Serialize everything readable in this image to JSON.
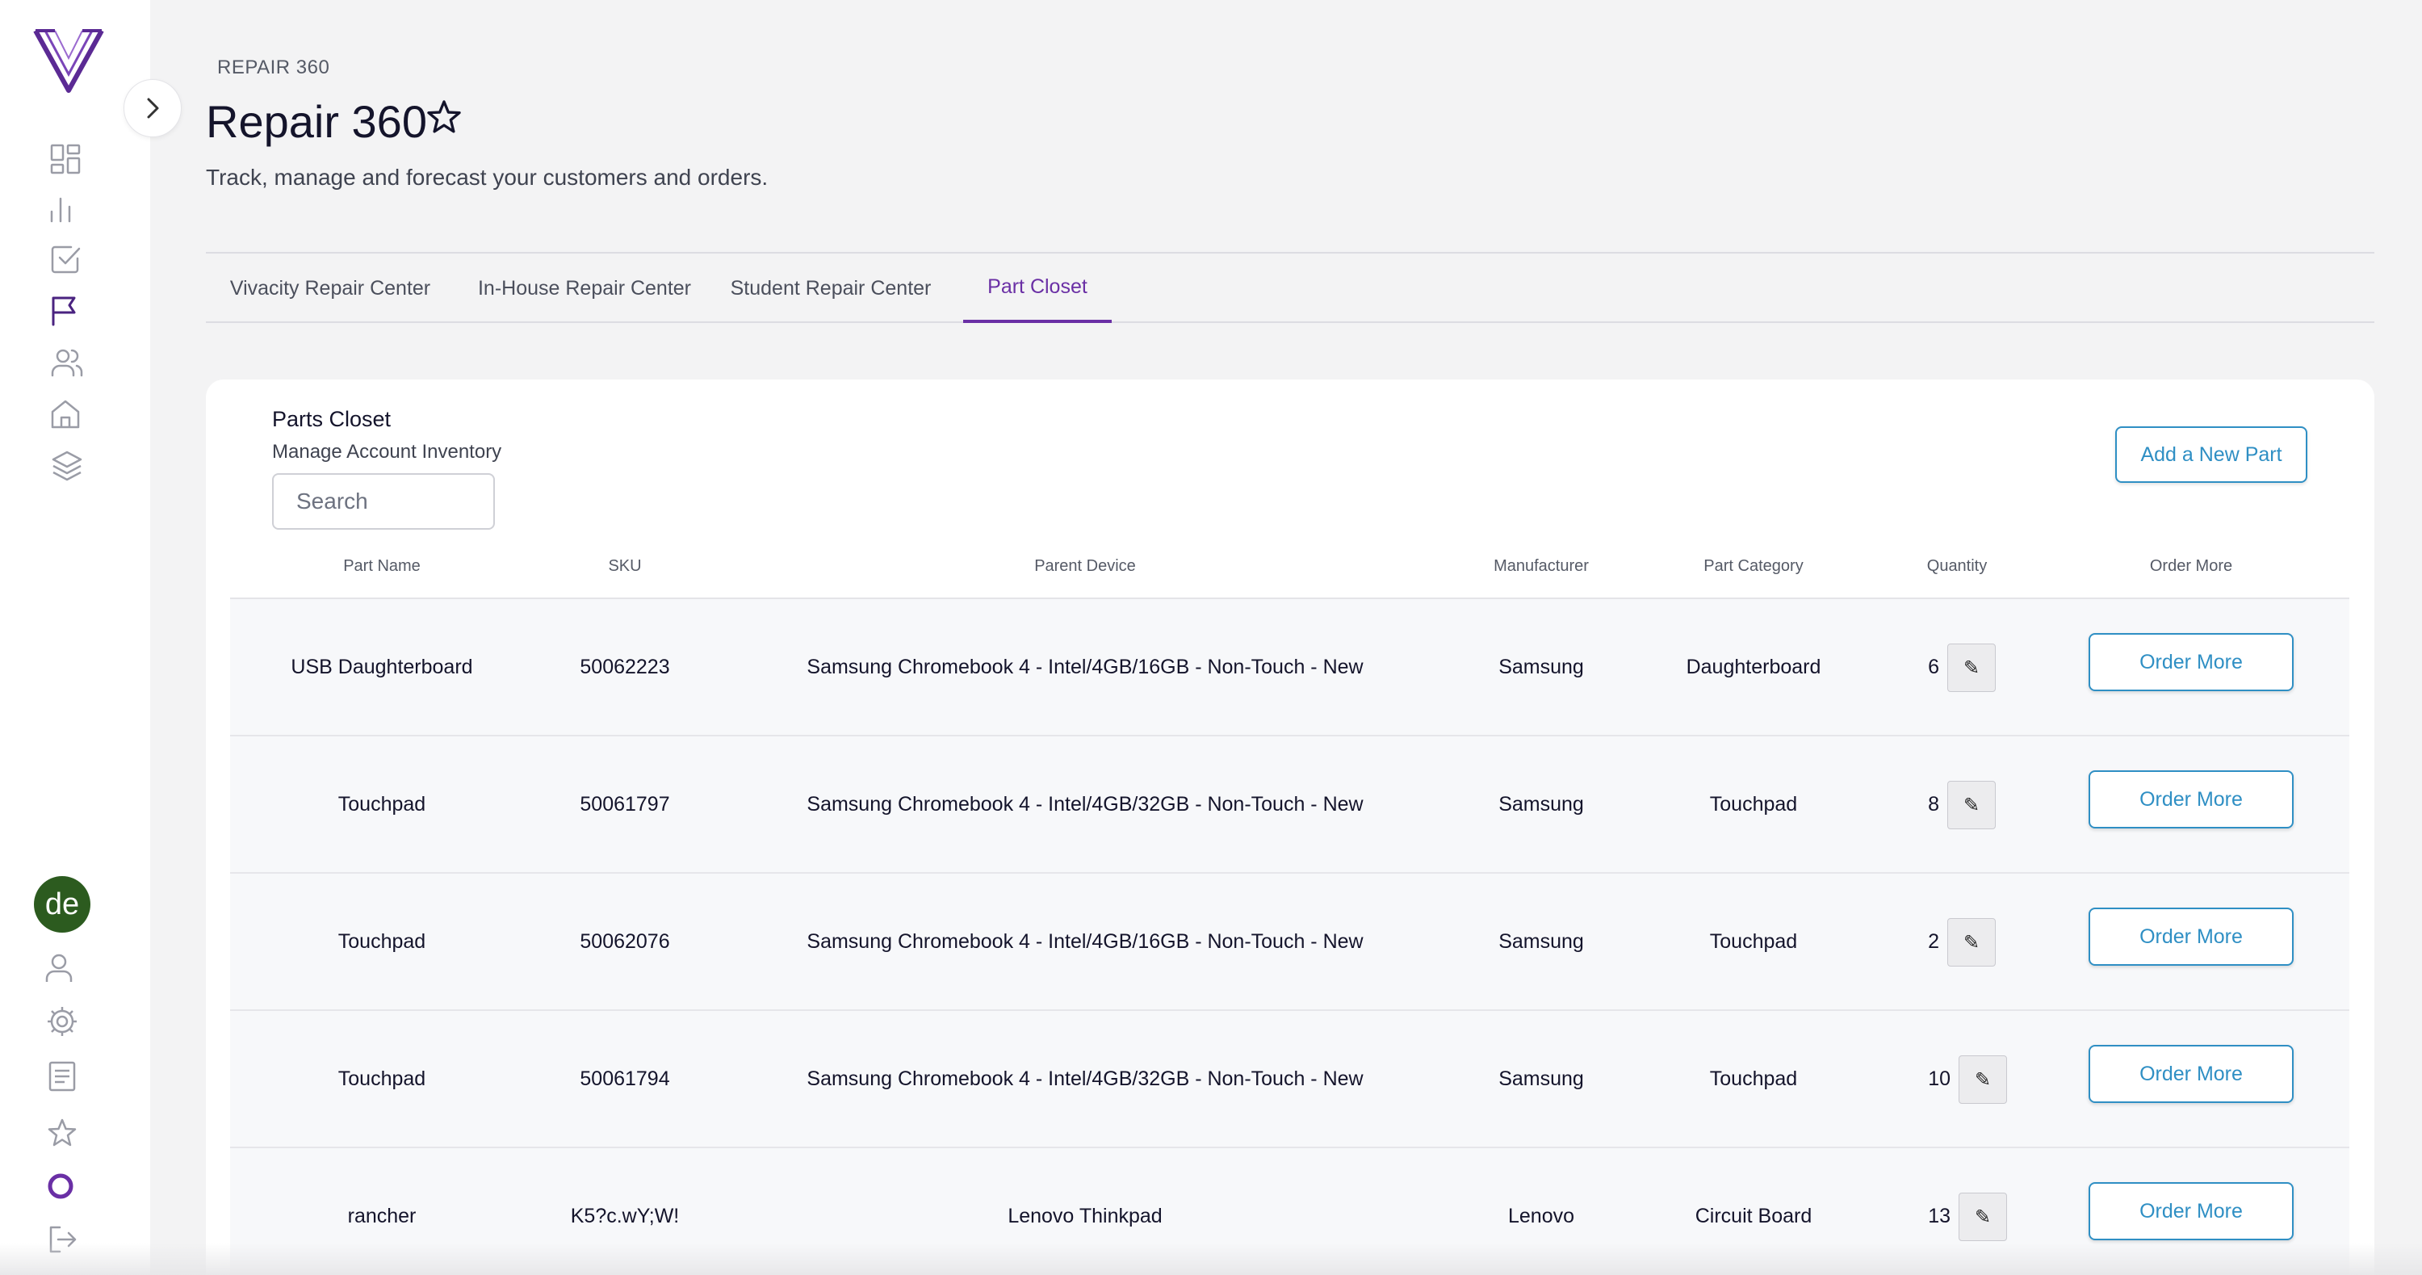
{
  "header": {
    "breadcrumb": "REPAIR 360",
    "title": "Repair 360",
    "subtitle": "Track, manage and forecast your customers and orders."
  },
  "sidebar": {
    "avatar_initials": "de",
    "top_icons": [
      "dashboard-icon",
      "chart-icon",
      "checkbox-icon",
      "flag-icon",
      "users-icon",
      "home-icon",
      "layers-icon"
    ],
    "bottom_icons": [
      "user-icon",
      "gear-icon",
      "document-icon",
      "star-icon",
      "circle-icon",
      "logout-icon"
    ],
    "accent_color": "#6a2fa5"
  },
  "tabs": [
    {
      "label": "Vivacity Repair Center",
      "active": false
    },
    {
      "label": "In-House Repair Center",
      "active": false
    },
    {
      "label": "Student Repair Center",
      "active": false
    },
    {
      "label": "Part Closet",
      "active": true
    }
  ],
  "card": {
    "title": "Parts Closet",
    "subtitle": "Manage Account Inventory",
    "search_placeholder": "Search",
    "add_button": "Add a New Part"
  },
  "table": {
    "columns": [
      "Part Name",
      "SKU",
      "Parent Device",
      "Manufacturer",
      "Part Category",
      "Quantity",
      "Order More"
    ],
    "rows": [
      {
        "part_name": "USB Daughterboard",
        "sku": "50062223",
        "parent_device": "Samsung Chromebook 4 - Intel/4GB/16GB - Non-Touch - New",
        "manufacturer": "Samsung",
        "category": "Daughterboard",
        "quantity": "6",
        "edit": "✎",
        "order": "Order More"
      },
      {
        "part_name": "Touchpad",
        "sku": "50061797",
        "parent_device": "Samsung Chromebook 4 - Intel/4GB/32GB - Non-Touch - New",
        "manufacturer": "Samsung",
        "category": "Touchpad",
        "quantity": "8",
        "edit": "✎",
        "order": "Order More"
      },
      {
        "part_name": "Touchpad",
        "sku": "50062076",
        "parent_device": "Samsung Chromebook 4 - Intel/4GB/16GB - Non-Touch - New",
        "manufacturer": "Samsung",
        "category": "Touchpad",
        "quantity": "2",
        "edit": "✎",
        "order": "Order More"
      },
      {
        "part_name": "Touchpad",
        "sku": "50061794",
        "parent_device": "Samsung Chromebook 4 - Intel/4GB/32GB - Non-Touch - New",
        "manufacturer": "Samsung",
        "category": "Touchpad",
        "quantity": "10",
        "edit": "✎",
        "order": "Order More"
      },
      {
        "part_name": "rancher",
        "sku": "K5?c.wY;W!",
        "parent_device": "Lenovo Thinkpad",
        "manufacturer": "Lenovo",
        "category": "Circuit Board",
        "quantity": "13",
        "edit": "✎",
        "order": "Order More"
      }
    ]
  }
}
